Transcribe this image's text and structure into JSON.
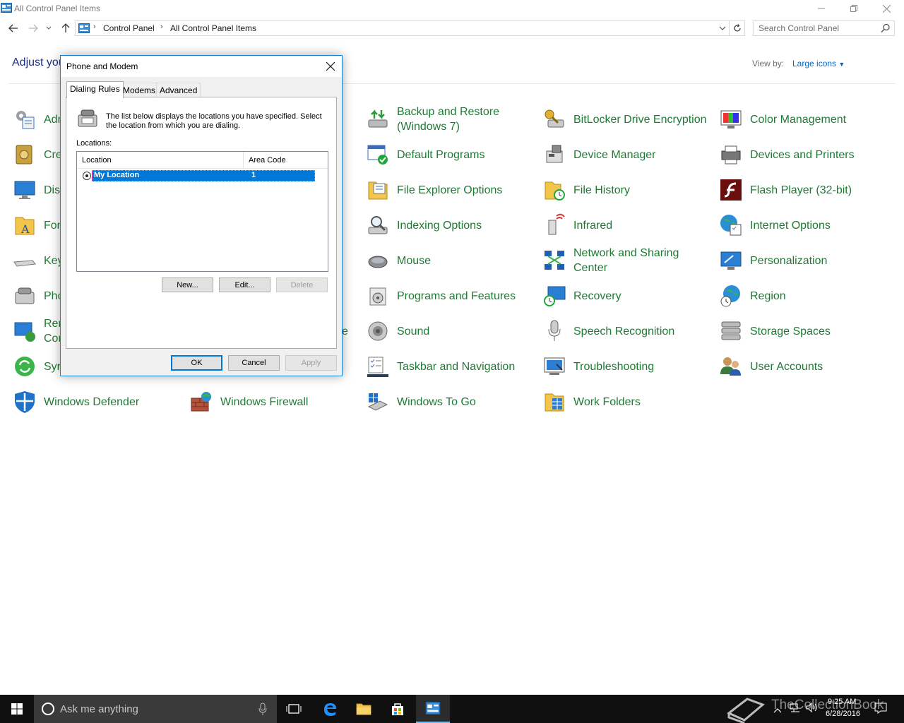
{
  "window": {
    "title": "All Control Panel Items"
  },
  "address": {
    "crumbs": [
      "Control Panel",
      "All Control Panel Items"
    ],
    "search_placeholder": "Search Control Panel"
  },
  "header": {
    "adjust_text": "Adjust you",
    "view_by_label": "View by:",
    "view_by_value": "Large icons"
  },
  "items": [
    {
      "label": "Adm",
      "icon": "admin-tools-icon"
    },
    {
      "label": "Cre",
      "icon": "credential-manager-icon"
    },
    {
      "label": "Dis",
      "icon": "display-icon"
    },
    {
      "label": "Fon",
      "icon": "fonts-icon"
    },
    {
      "label": "Key",
      "icon": "keyboard-icon"
    },
    {
      "label": "Pho",
      "icon": "phone-modem-icon"
    },
    {
      "label": "Rer\nCor",
      "icon": "remoteapp-icon"
    },
    {
      "label": "Syr",
      "icon": "sync-center-icon"
    },
    {
      "label": "Windows Defender",
      "icon": "windows-defender-icon"
    },
    {
      "label": "Windows Firewall",
      "icon": "windows-firewall-icon"
    },
    {
      "label": "Backup and Restore (Windows 7)",
      "icon": "backup-restore-icon"
    },
    {
      "label": "Default Programs",
      "icon": "default-programs-icon"
    },
    {
      "label": "File Explorer Options",
      "icon": "file-explorer-options-icon"
    },
    {
      "label": "Indexing Options",
      "icon": "indexing-options-icon"
    },
    {
      "label": "Mouse",
      "icon": "mouse-icon"
    },
    {
      "label": "Programs and Features",
      "icon": "programs-features-icon"
    },
    {
      "label": "Sound",
      "icon": "sound-icon"
    },
    {
      "label": "Taskbar and Navigation",
      "icon": "taskbar-navigation-icon"
    },
    {
      "label": "Windows To Go",
      "icon": "windows-to-go-icon"
    },
    {
      "label": "BitLocker Drive Encryption",
      "icon": "bitlocker-icon"
    },
    {
      "label": "Device Manager",
      "icon": "device-manager-icon"
    },
    {
      "label": "File History",
      "icon": "file-history-icon"
    },
    {
      "label": "Infrared",
      "icon": "infrared-icon"
    },
    {
      "label": "Network and Sharing Center",
      "icon": "network-sharing-icon"
    },
    {
      "label": "Recovery",
      "icon": "recovery-icon"
    },
    {
      "label": "Speech Recognition",
      "icon": "speech-recognition-icon"
    },
    {
      "label": "Troubleshooting",
      "icon": "troubleshooting-icon"
    },
    {
      "label": "Work Folders",
      "icon": "work-folders-icon"
    },
    {
      "label": "Color Management",
      "icon": "color-management-icon"
    },
    {
      "label": "Devices and Printers",
      "icon": "devices-printers-icon"
    },
    {
      "label": "Flash Player (32-bit)",
      "icon": "flash-player-icon"
    },
    {
      "label": "Internet Options",
      "icon": "internet-options-icon"
    },
    {
      "label": "Personalization",
      "icon": "personalization-icon"
    },
    {
      "label": "Region",
      "icon": "region-icon"
    },
    {
      "label": "Storage Spaces",
      "icon": "storage-spaces-icon"
    },
    {
      "label": "User Accounts",
      "icon": "user-accounts-icon"
    },
    {
      "label": "e",
      "icon": ""
    }
  ],
  "dialog": {
    "title": "Phone and Modem",
    "tabs": [
      "Dialing Rules",
      "Modems",
      "Advanced"
    ],
    "description": "The list below displays the locations you have specified. Select the location from which you are dialing.",
    "locations_label": "Locations:",
    "columns": [
      "Location",
      "Area Code"
    ],
    "rows": [
      {
        "location": "My Location",
        "area_code": "1"
      }
    ],
    "buttons": {
      "new": "New...",
      "edit": "Edit...",
      "delete": "Delete",
      "ok": "OK",
      "cancel": "Cancel",
      "apply": "Apply"
    }
  },
  "taskbar": {
    "search_text": "Ask me anything",
    "time": "9:25 AM",
    "date": "6/28/2016",
    "watermark": "TheCollectionBook"
  },
  "colors": {
    "link_green": "#1f7a34",
    "accent": "#0078d7",
    "taskbar": "#101010"
  }
}
